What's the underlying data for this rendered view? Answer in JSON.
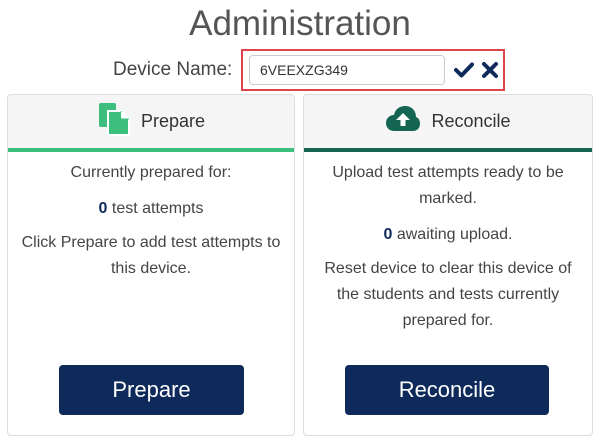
{
  "page": {
    "title": "Administration"
  },
  "device": {
    "label": "Device Name:",
    "value": "6VEEXZG349",
    "confirm_icon": "check-icon",
    "cancel_icon": "close-icon"
  },
  "prepare_card": {
    "header_label": "Prepare",
    "icon": "copy-documents-icon",
    "accent_color": "#3cbf7c",
    "line1": "Currently prepared for:",
    "count": "0",
    "count_suffix": " test attempts",
    "line3": "Click Prepare to add test attempts to this device.",
    "button_label": "Prepare"
  },
  "reconcile_card": {
    "header_label": "Reconcile",
    "icon": "cloud-upload-icon",
    "accent_color": "#146652",
    "line1": "Upload test attempts ready to be marked.",
    "count": "0",
    "count_suffix": " awaiting upload.",
    "line3": "Reset device to clear this device of the students and tests currently prepared for.",
    "button_label": "Reconcile"
  },
  "colors": {
    "button_bg": "#0e2a5a",
    "highlight_border": "#e0444b"
  }
}
